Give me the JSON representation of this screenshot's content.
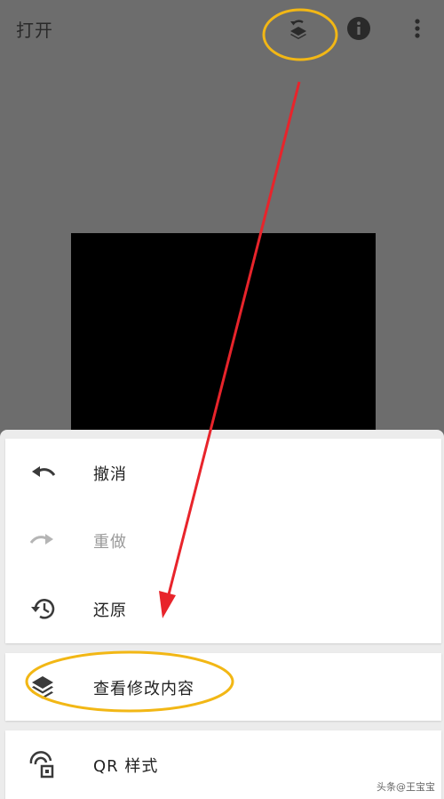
{
  "header": {
    "title": "打开",
    "icons": [
      "layers-icon",
      "info-icon",
      "more-vert-icon"
    ]
  },
  "menu": {
    "history": [
      {
        "label": "撤消",
        "icon": "undo-icon",
        "enabled": true
      },
      {
        "label": "重做",
        "icon": "redo-icon",
        "enabled": false
      },
      {
        "label": "还原",
        "icon": "restore-history-icon",
        "enabled": true
      }
    ],
    "view_edits": {
      "label": "查看修改内容",
      "icon": "layers-icon"
    },
    "qr": {
      "label": "QR 样式",
      "icon": "qr-style-icon"
    }
  },
  "annotation": {
    "highlight_color": "#f2b715",
    "arrow_color": "#e8242b"
  },
  "watermark": {
    "text": "头条@王宝宝"
  },
  "colors": {
    "canvas_background": "#6d6d6d",
    "image": "#000000",
    "sheet": "#ececec",
    "card": "#ffffff"
  }
}
